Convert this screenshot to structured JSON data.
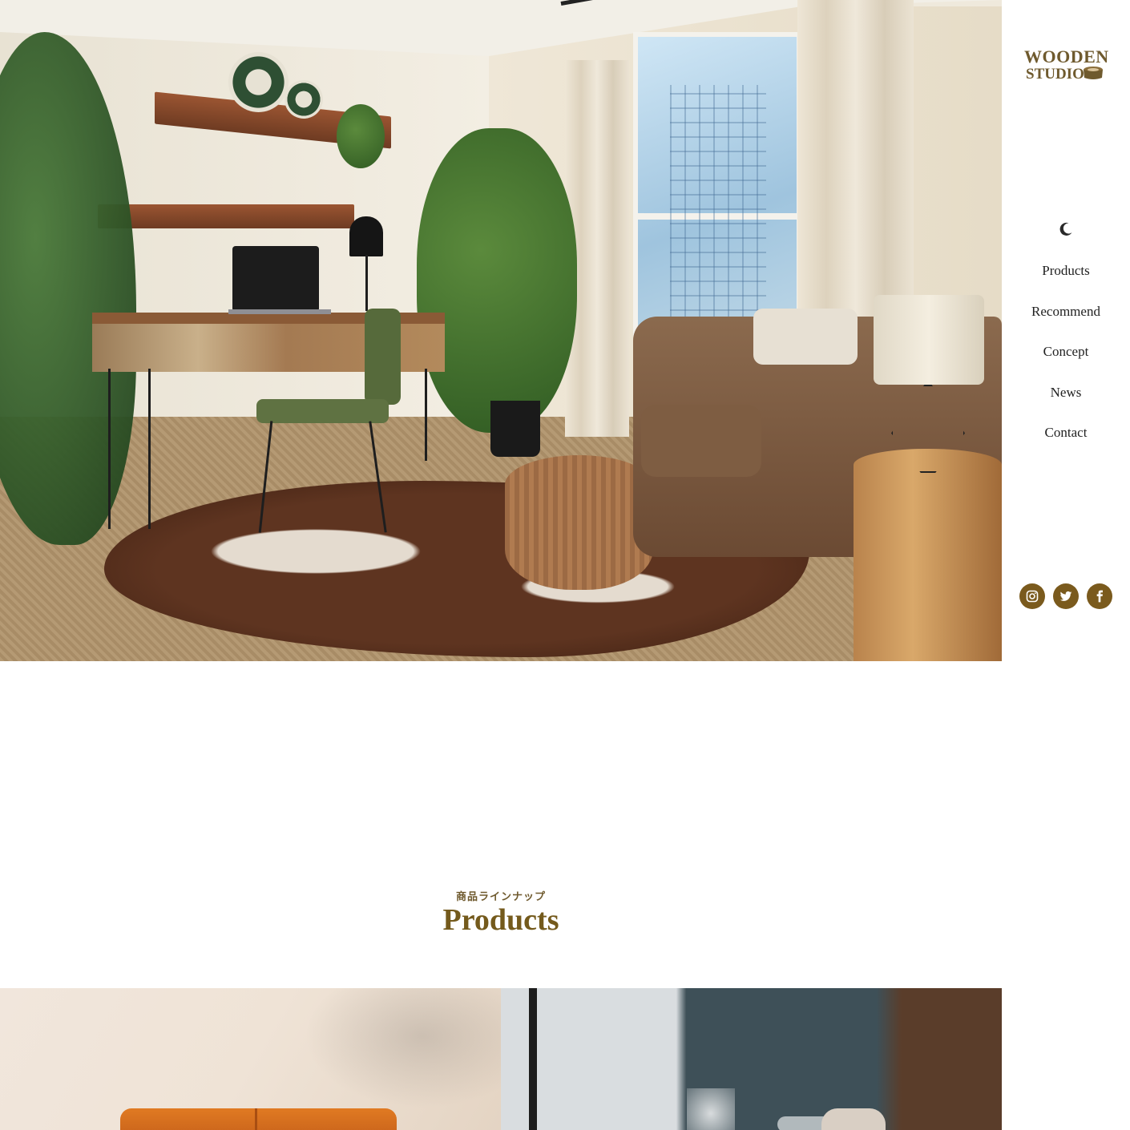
{
  "brand": {
    "line1": "WOODEN",
    "line2": "STUDIO"
  },
  "sidebar": {
    "theme_toggle_icon": "moon-icon",
    "nav": [
      {
        "label": "Products"
      },
      {
        "label": "Recommend"
      },
      {
        "label": "Concept"
      },
      {
        "label": "News"
      },
      {
        "label": "Contact"
      }
    ],
    "social": [
      {
        "icon": "instagram-icon"
      },
      {
        "icon": "twitter-icon"
      },
      {
        "icon": "facebook-icon"
      }
    ]
  },
  "products": {
    "subtitle": "商品ラインナップ",
    "title": "Products"
  },
  "colors": {
    "accent": "#7a5a1d",
    "title": "#745a1c",
    "text": "#222222"
  }
}
